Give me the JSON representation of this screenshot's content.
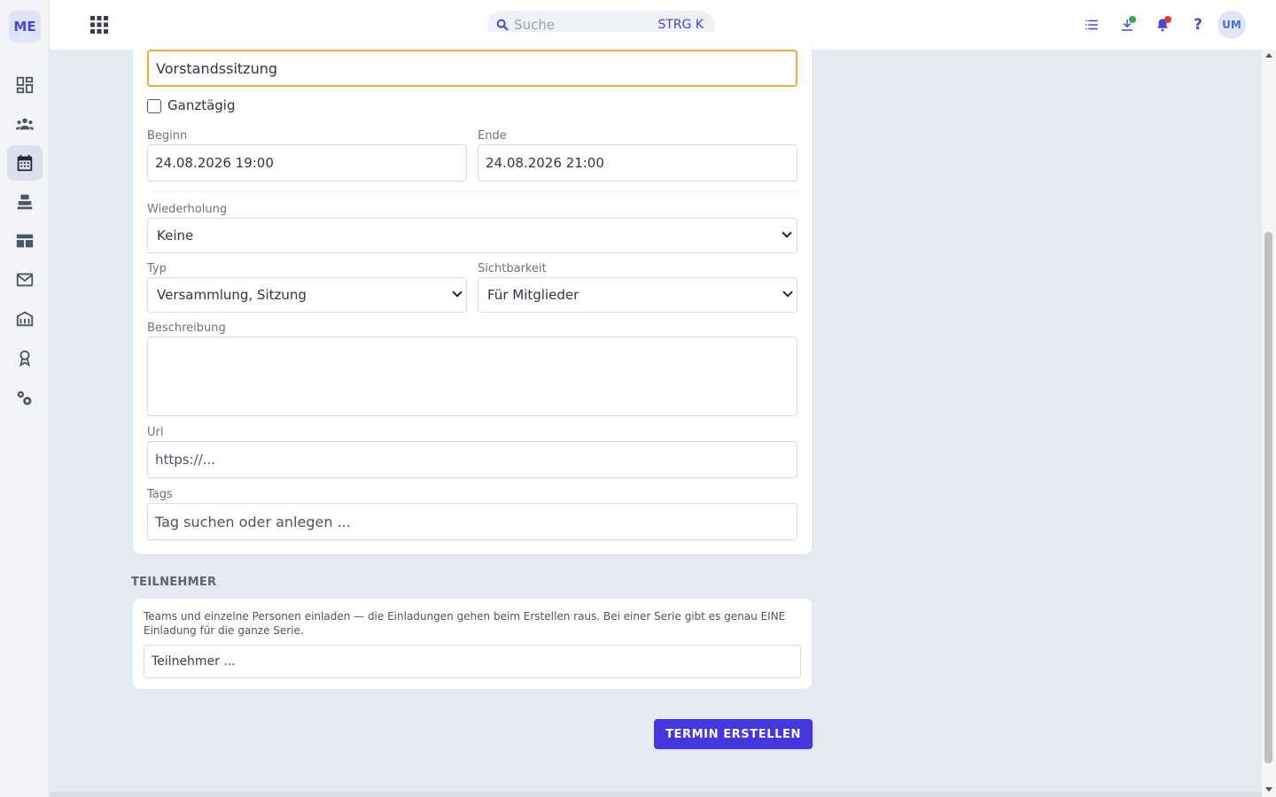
{
  "app": {
    "logo": "ME",
    "avatar": "UM"
  },
  "search": {
    "placeholder": "Suche",
    "shortcut": "STRG K"
  },
  "sidebar": {
    "items": [
      {
        "icon": "dashboard-icon"
      },
      {
        "icon": "people-icon"
      },
      {
        "icon": "calendar-icon",
        "active": true
      },
      {
        "icon": "cashbox-icon"
      },
      {
        "icon": "table-icon"
      },
      {
        "icon": "mail-icon"
      },
      {
        "icon": "building-icon"
      },
      {
        "icon": "award-icon"
      },
      {
        "icon": "settings-icon"
      }
    ]
  },
  "topbar": {
    "icons": [
      "list-icon",
      "download-icon",
      "bell-icon",
      "help-icon"
    ],
    "help_label": "?",
    "colors": {
      "download_dot": "#2fa84f",
      "bell_dot": "#e53935"
    }
  },
  "form": {
    "title_value": "Vorstandssitzung",
    "all_day_label": "Ganztägig",
    "begin_label": "Beginn",
    "begin_value": "24.08.2026 19:00",
    "end_label": "Ende",
    "end_value": "24.08.2026 21:00",
    "repeat_label": "Wiederholung",
    "repeat_value": "Keine",
    "type_label": "Typ",
    "type_value": "Versammlung, Sitzung",
    "visibility_label": "Sichtbarkeit",
    "visibility_value": "Für Mitglieder",
    "description_label": "Beschreibung",
    "url_label": "Url",
    "url_placeholder": "https://...",
    "tags_label": "Tags",
    "tags_placeholder": "Tag suchen oder anlegen ..."
  },
  "participants": {
    "section_title": "TEILNEHMER",
    "hint": "Teams und einzelne Personen einladen — die Einladungen gehen beim Erstellen raus. Bei einer Serie gibt es genau EINE Einladung für die ganze Serie.",
    "placeholder": "Teilnehmer ..."
  },
  "actions": {
    "submit_label": "TERMIN ERSTELLEN"
  },
  "colors": {
    "accent": "#4338e0",
    "focus": "#f2a93b"
  }
}
